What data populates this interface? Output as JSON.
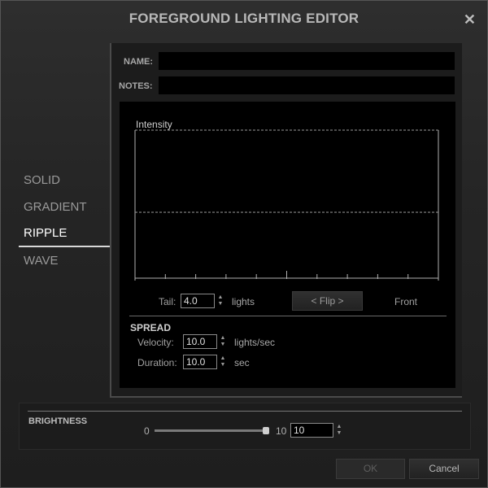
{
  "window": {
    "title": "FOREGROUND LIGHTING EDITOR",
    "close_glyph": "✕"
  },
  "nav": {
    "items": [
      {
        "label": "SOLID",
        "active": false
      },
      {
        "label": "GRADIENT",
        "active": false
      },
      {
        "label": "RIPPLE",
        "active": true
      },
      {
        "label": "WAVE",
        "active": false
      }
    ]
  },
  "form": {
    "name_label": "NAME:",
    "name_value": "",
    "notes_label": "NOTES:",
    "notes_value": ""
  },
  "graph": {
    "label": "Intensity",
    "intensity_level": 0.5
  },
  "tail": {
    "label": "Tail:",
    "value": "4.0",
    "unit": "lights"
  },
  "flip_button": "< Flip >",
  "front_label": "Front",
  "spread": {
    "title": "SPREAD",
    "velocity": {
      "label": "Velocity:",
      "value": "10.0",
      "unit": "lights/sec"
    },
    "duration": {
      "label": "Duration:",
      "value": "10.0",
      "unit": "sec"
    }
  },
  "brightness": {
    "title": "BRIGHTNESS",
    "min": "0",
    "max": "10",
    "value": "10",
    "level": 1.0
  },
  "footer": {
    "ok_label": "OK",
    "cancel_label": "Cancel"
  },
  "icons": {
    "close": "close-icon",
    "spinner": "spinner-arrows-icon",
    "slider": "slider-thumb"
  },
  "colors": {
    "background": "#252525",
    "panel": "#1c1c1c",
    "field": "#000000",
    "text_active": "#ffffff"
  }
}
